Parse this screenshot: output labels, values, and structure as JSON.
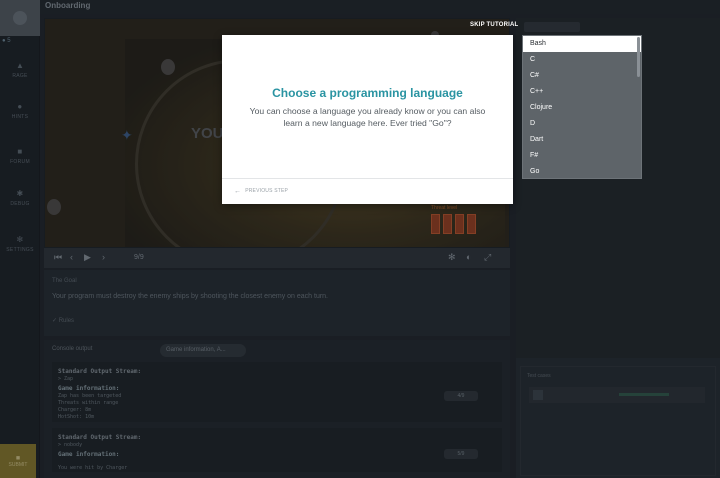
{
  "header": {
    "title": "Onboarding",
    "skip_label": "SKIP TUTORIAL"
  },
  "rail": {
    "level": "5",
    "items": [
      {
        "label": "RAGE",
        "icon": "flame-icon"
      },
      {
        "label": "HINTS",
        "icon": "lightbulb-icon"
      },
      {
        "label": "FORUM",
        "icon": "chat-icon"
      },
      {
        "label": "DEBUG",
        "icon": "bug-icon"
      },
      {
        "label": "SETTINGS",
        "icon": "gear-icon"
      }
    ],
    "bottom_label": "SUBMIT"
  },
  "video": {
    "you_text": "YOU",
    "threat_label": "Threat level",
    "frame_counter": "9/9"
  },
  "statement": {
    "label": "The Goal",
    "text": "Your program must destroy the enemy ships by shooting the closest enemy on each turn.",
    "rules_label": "Rules"
  },
  "console": {
    "header": "Console output",
    "filter_chip": "Game information, A...",
    "blocks": [
      {
        "lines": [
          "Standard Output Stream:",
          "> Zap"
        ],
        "info_title": "Game information:",
        "info_lines": [
          "Zap has been targeted",
          "Threats within range",
          "Charger: 8m",
          "HotShot: 10m"
        ],
        "pill": "4/9"
      },
      {
        "lines": [
          "Standard Output Stream:",
          "> nobody"
        ],
        "info_title": "Game information:",
        "info_lines": [
          "You were hit by Charger"
        ],
        "pill": "5/9"
      }
    ]
  },
  "right": {
    "bottom_header": "Test cases"
  },
  "modal": {
    "title": "Choose a programming language",
    "body": "You can choose a language you already know or you can also learn a new language here. Ever tried \"Go\"?",
    "prev_label": "PREVIOUS STEP"
  },
  "languages": {
    "selected": "Bash",
    "options": [
      "Bash",
      "C",
      "C#",
      "C++",
      "Clojure",
      "D",
      "Dart",
      "F#",
      "Go"
    ]
  },
  "colors": {
    "accent": "#2a94a2",
    "dropdown_bg": "#5e6469"
  }
}
